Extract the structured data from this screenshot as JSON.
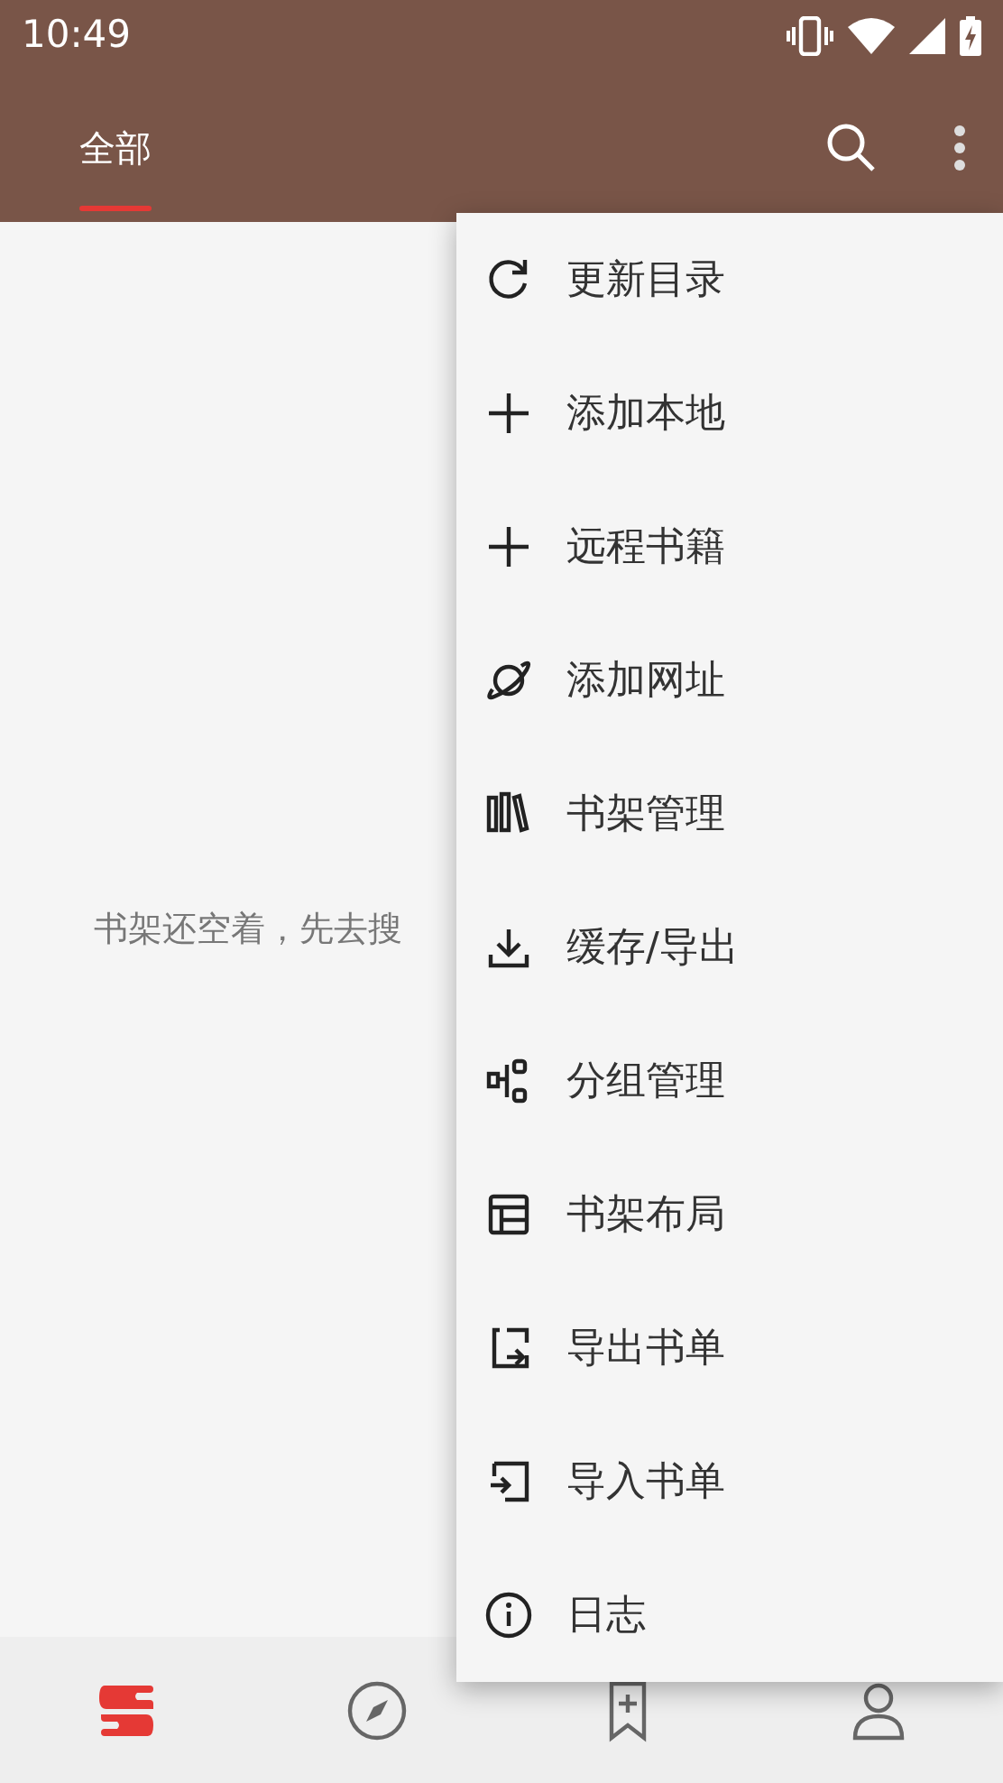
{
  "status_bar": {
    "time": "10:49"
  },
  "tabs": [
    {
      "label": "全部",
      "selected": true
    }
  ],
  "empty_message": "书架还空着，先去搜",
  "menu": {
    "items": [
      {
        "label": "更新目录"
      },
      {
        "label": "添加本地"
      },
      {
        "label": "远程书籍"
      },
      {
        "label": "添加网址"
      },
      {
        "label": "书架管理"
      },
      {
        "label": "缓存/导出"
      },
      {
        "label": "分组管理"
      },
      {
        "label": "书架布局"
      },
      {
        "label": "导出书单"
      },
      {
        "label": "导入书单"
      },
      {
        "label": "日志"
      }
    ]
  },
  "bottom_nav": [
    {
      "selected": true
    },
    {
      "selected": false
    },
    {
      "selected": false
    },
    {
      "selected": false
    }
  ]
}
